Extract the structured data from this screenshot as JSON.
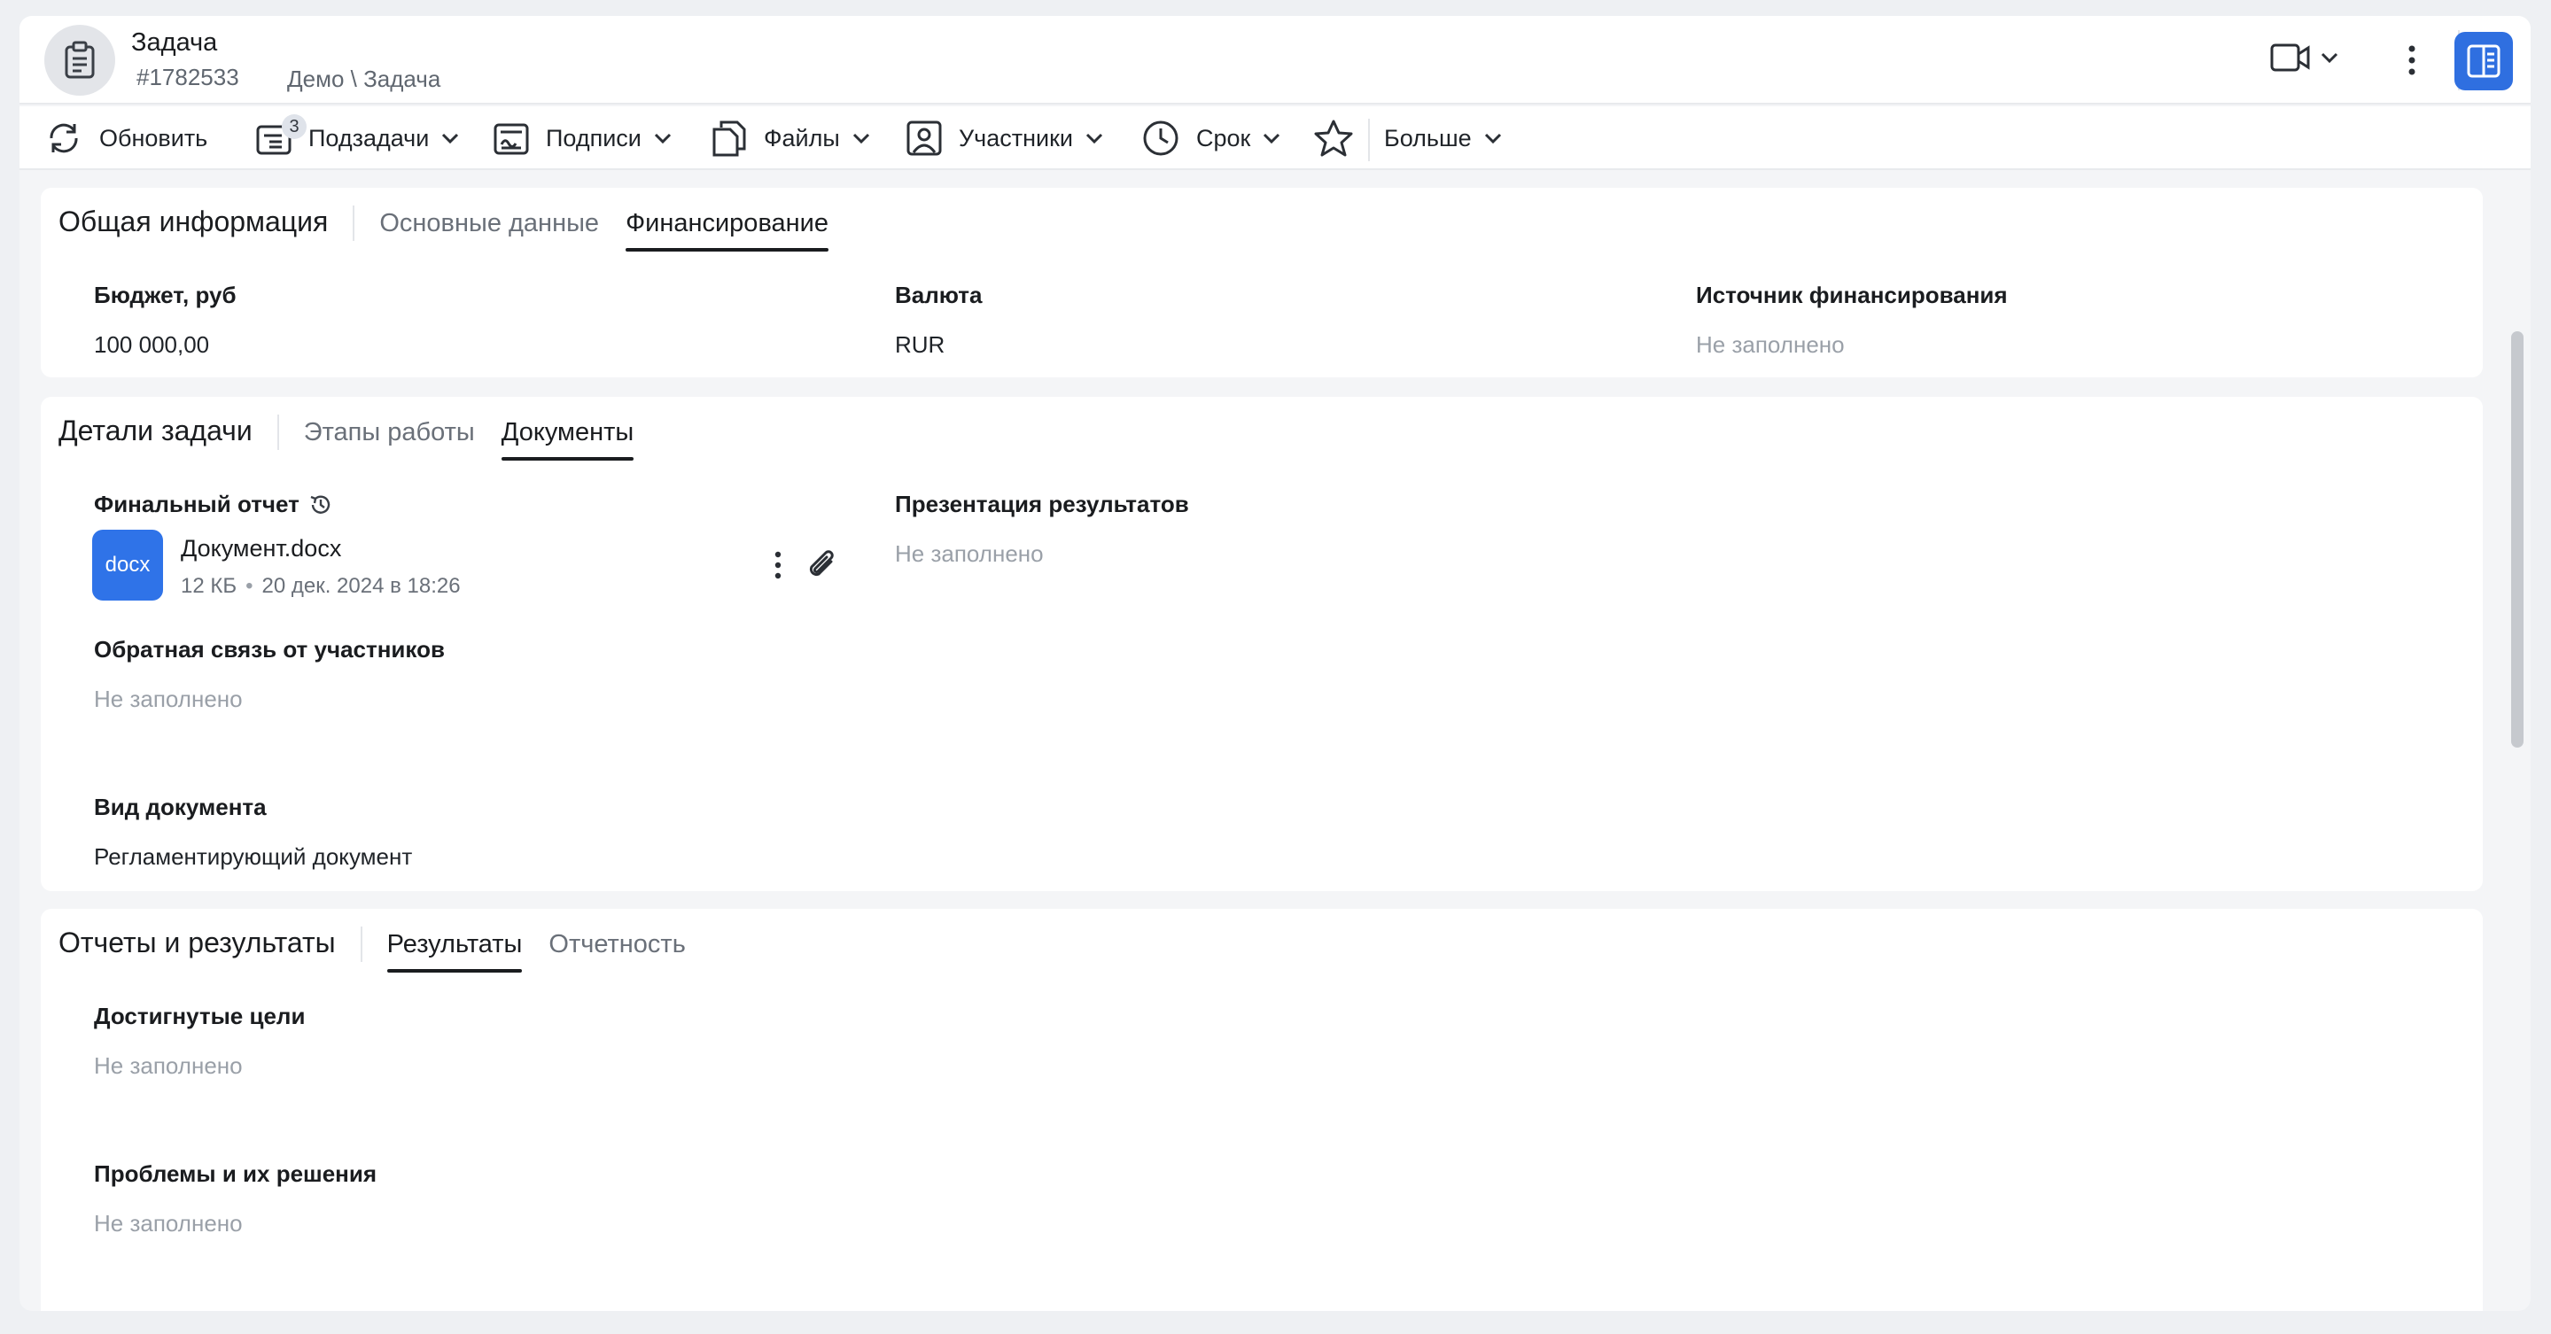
{
  "header": {
    "title": "Задача",
    "task_id": "#1782533",
    "breadcrumb": "Демо \\ Задача",
    "accent_color": "#2f6fe0"
  },
  "toolbar": {
    "refresh_label": "Обновить",
    "subtasks_label": "Подзадачи",
    "subtasks_count": "3",
    "signatures_label": "Подписи",
    "files_label": "Файлы",
    "participants_label": "Участники",
    "deadline_label": "Срок",
    "more_label": "Больше"
  },
  "general": {
    "title": "Общая информация",
    "tabs": [
      "Основные данные",
      "Финансирование"
    ],
    "active_tab": "Финансирование",
    "fields": [
      {
        "label": "Бюджет, руб",
        "value": "100 000,00"
      },
      {
        "label": "Валюта",
        "value": "RUR"
      },
      {
        "label": "Источник финансирования",
        "value": "Не заполнено"
      }
    ]
  },
  "details": {
    "title": "Детали задачи",
    "tabs": [
      "Этапы работы",
      "Документы"
    ],
    "active_tab": "Документы",
    "final_report": {
      "label": "Финальный отчет",
      "file_type": "docx",
      "file_name": "Документ.docx",
      "file_size": "12 КБ",
      "file_date": "20 дек. 2024 в 18:26"
    },
    "presentation": {
      "label": "Презентация результатов",
      "value": "Не заполнено"
    },
    "feedback": {
      "label": "Обратная связь от участников",
      "value": "Не заполнено"
    },
    "doc_kind": {
      "label": "Вид документа",
      "value": "Регламентирующий документ"
    }
  },
  "reports": {
    "title": "Отчеты и результаты",
    "tabs": [
      "Результаты",
      "Отчетность"
    ],
    "active_tab": "Результаты",
    "goals": {
      "label": "Достигнутые цели",
      "value": "Не заполнено"
    },
    "problems": {
      "label": "Проблемы и их решения",
      "value": "Не заполнено"
    }
  }
}
